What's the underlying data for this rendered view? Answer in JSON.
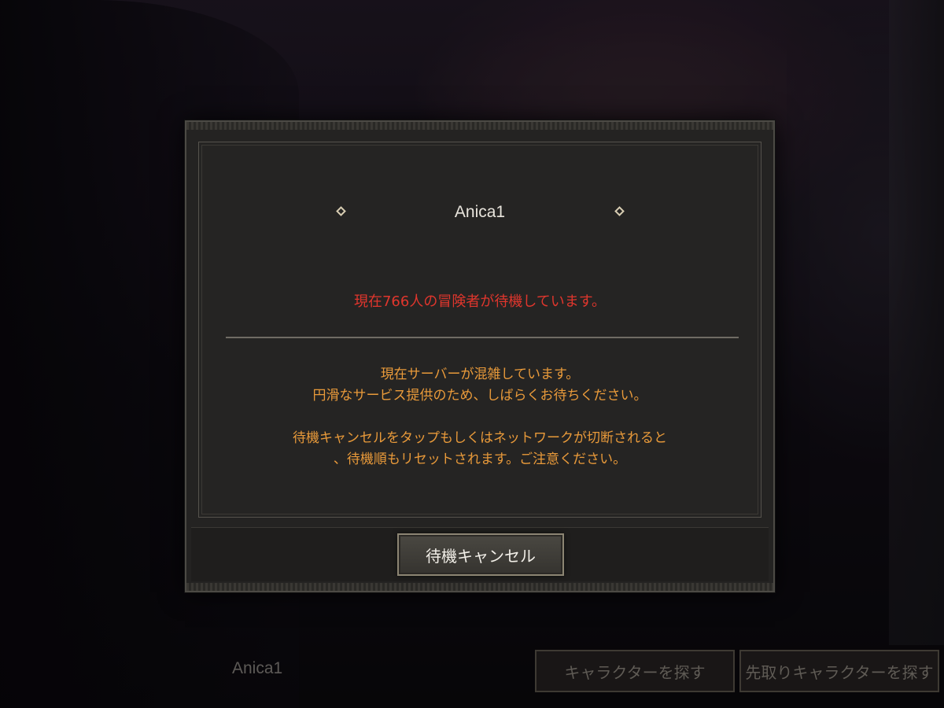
{
  "dialog": {
    "title": "Anica1",
    "waiting_message": "現在766人の冒険者が待機しています。",
    "message_lines_1": [
      "現在サーバーが混雑しています。",
      "円滑なサービス提供のため、しばらくお待ちください。"
    ],
    "message_lines_2": [
      "待機キャンセルをタップもしくはネットワークが切断されると",
      "、待機順もリセットされます。ご注意ください。"
    ],
    "cancel_label": "待機キャンセル"
  },
  "bottom_bar": {
    "character_name": "Anica1",
    "find_character_label": "キャラクターを探す",
    "preorder_character_label": "先取りキャラクターを探す"
  },
  "colors": {
    "warning_red": "#e0362d",
    "message_orange": "#e99a3a",
    "panel_bg": "#242322"
  }
}
